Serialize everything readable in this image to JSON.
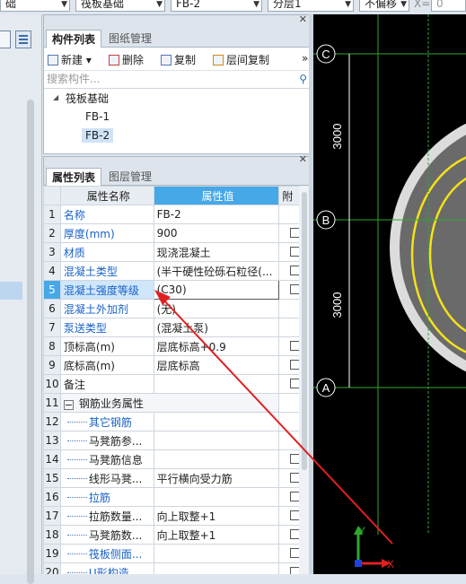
{
  "topbar": {
    "combo1": "础",
    "combo2": "筏板基础",
    "combo3": "FB-2",
    "combo4": "分层1",
    "combo5": "不偏移",
    "x_label": "X=",
    "x_value": "0"
  },
  "component_panel": {
    "tabs": [
      "构件列表",
      "图纸管理"
    ],
    "toolbar": {
      "new": "新建",
      "delete": "删除",
      "copy": "复制",
      "floor_copy": "层间复制"
    },
    "search_placeholder": "搜索构件...",
    "tree": {
      "root": "筏板基础",
      "items": [
        "FB-1",
        "FB-2"
      ],
      "selected": "FB-2"
    }
  },
  "property_panel": {
    "tabs": [
      "属性列表",
      "图层管理"
    ],
    "headers": {
      "name": "属性名称",
      "value": "属性值",
      "attach": "附"
    },
    "rows": [
      {
        "n": "1",
        "name": "名称",
        "value": "FB-2",
        "blue": true,
        "check": false
      },
      {
        "n": "2",
        "name": "厚度(mm)",
        "value": "900",
        "blue": true,
        "check": true
      },
      {
        "n": "3",
        "name": "材质",
        "value": "现浇混凝土",
        "blue": true,
        "check": true
      },
      {
        "n": "4",
        "name": "混凝土类型",
        "value": "(半干硬性砼砾石粒径(...",
        "blue": true,
        "check": true
      },
      {
        "n": "5",
        "name": "混凝土强度等级",
        "value": "(C30)",
        "blue": true,
        "check": true
      },
      {
        "n": "6",
        "name": "混凝土外加剂",
        "value": "(无)",
        "blue": true,
        "check": false
      },
      {
        "n": "7",
        "name": "泵送类型",
        "value": "(混凝土泵)",
        "blue": true,
        "check": false
      },
      {
        "n": "8",
        "name": "顶标高(m)",
        "value": "层底标高+0.9",
        "blue": false,
        "check": true
      },
      {
        "n": "9",
        "name": "底标高(m)",
        "value": "层底标高",
        "blue": false,
        "check": true
      },
      {
        "n": "10",
        "name": "备注",
        "value": "",
        "blue": false,
        "check": true
      },
      {
        "n": "11",
        "name": "钢筋业务属性",
        "value": "",
        "blue": false,
        "check": false
      },
      {
        "n": "12",
        "name": "其它钢筋",
        "value": "",
        "blue": true,
        "check": false
      },
      {
        "n": "13",
        "name": "马凳筋参...",
        "value": "",
        "blue": false,
        "check": false
      },
      {
        "n": "14",
        "name": "马凳筋信息",
        "value": "",
        "blue": false,
        "check": true
      },
      {
        "n": "15",
        "name": "线形马凳...",
        "value": "平行横向受力筋",
        "blue": false,
        "check": true
      },
      {
        "n": "16",
        "name": "拉筋",
        "value": "",
        "blue": true,
        "check": true
      },
      {
        "n": "17",
        "name": "拉筋数量...",
        "value": "向上取整+1",
        "blue": false,
        "check": true
      },
      {
        "n": "18",
        "name": "马凳筋数...",
        "value": "向上取整+1",
        "blue": false,
        "check": true
      },
      {
        "n": "19",
        "name": "筏板侧面...",
        "value": "",
        "blue": true,
        "check": true
      },
      {
        "n": "20",
        "name": "U形构造...",
        "value": "",
        "blue": true,
        "check": true
      }
    ]
  },
  "canvas": {
    "axes": [
      "C",
      "B",
      "A"
    ],
    "dims": [
      "3000",
      "3000"
    ],
    "ucs_x": "X",
    "ucs_y": "Y"
  },
  "colors": {
    "header_blue": "#47a8e8",
    "arrow_red": "#e02020",
    "axis_green": "#2ea82e",
    "arc_yellow": "#f4e11a"
  }
}
